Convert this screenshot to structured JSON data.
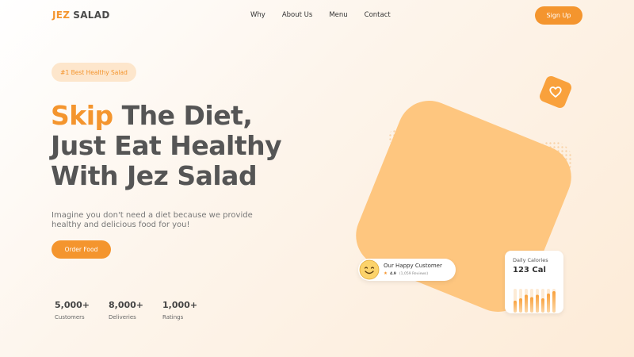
{
  "header": {
    "logo_part1": "JEZ",
    "logo_part2": "SALAD",
    "nav": [
      "Why",
      "About Us",
      "Menu",
      "Contact"
    ],
    "signup_label": "Sign Up"
  },
  "hero": {
    "badge": "#1 Best Healthy Salad",
    "headline_accent": "Skip",
    "headline_line1_rest": " The Diet,",
    "headline_line2": "Just Eat Healthy",
    "headline_line3": "With Jez Salad",
    "subtext": "Imagine you don't need a diet because we provide healthy and delicious food for you!",
    "order_label": "Order Food"
  },
  "stats": [
    {
      "value": "5,000+",
      "label": "Customers"
    },
    {
      "value": "8,000+",
      "label": "Deliveries"
    },
    {
      "value": "1,000+",
      "label": "Ratings"
    }
  ],
  "customer_card": {
    "title": "Our Happy Customer",
    "score": "4.9",
    "reviews": "(1,059 Reviews)"
  },
  "calories_card": {
    "title": "Daily Calories",
    "value": "123 Cal",
    "bar_levels": [
      0.5,
      0.6,
      0.75,
      0.65,
      0.75,
      0.6,
      0.8,
      0.9
    ]
  },
  "colors": {
    "accent": "#f4952e",
    "shape": "#fec67f",
    "badge_bg": "#fde6cc"
  }
}
